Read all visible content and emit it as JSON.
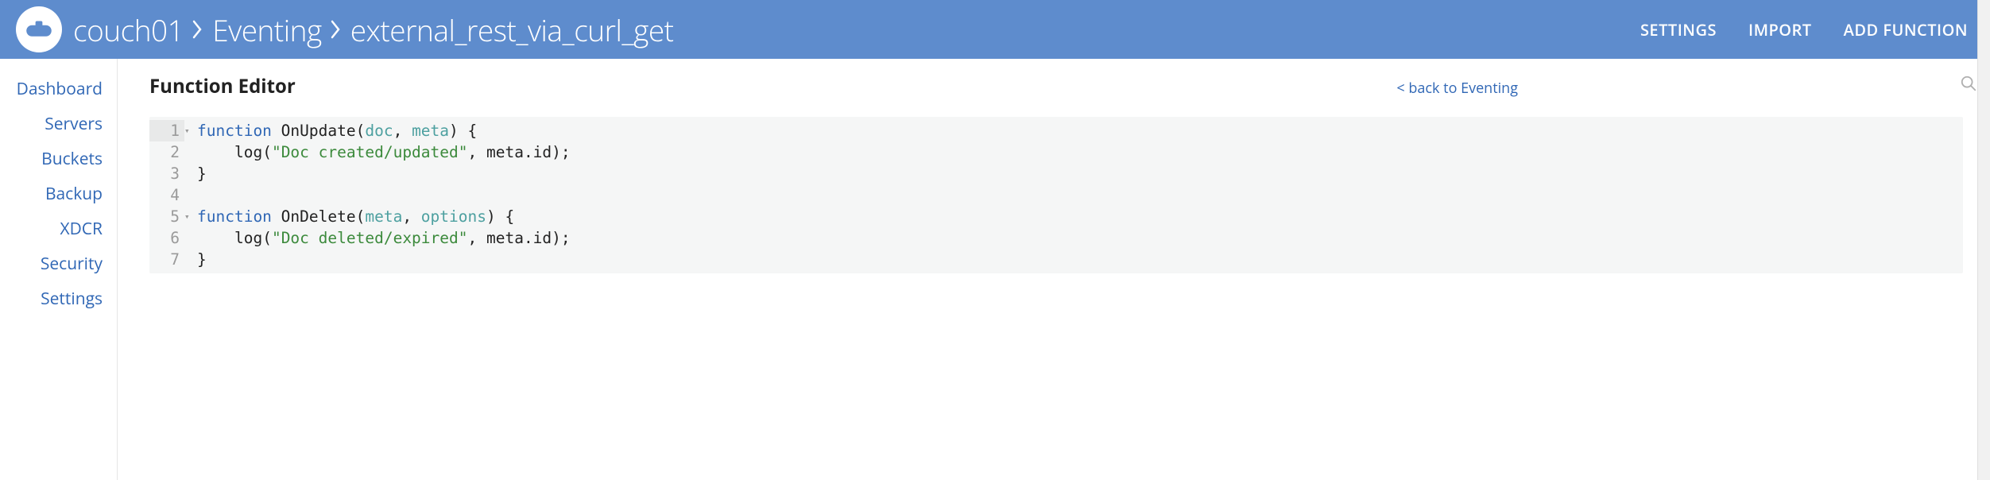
{
  "header": {
    "breadcrumb": [
      "couch01",
      "Eventing",
      "external_rest_via_curl_get"
    ],
    "actions": {
      "settings": "SETTINGS",
      "import": "IMPORT",
      "add_function": "ADD FUNCTION"
    }
  },
  "sidebar": {
    "items": [
      "Dashboard",
      "Servers",
      "Buckets",
      "Backup",
      "XDCR",
      "Security",
      "Settings"
    ]
  },
  "main": {
    "title": "Function Editor",
    "back_link": "< back to Eventing"
  },
  "code": {
    "lines": [
      {
        "num": "1",
        "fold": true,
        "tokens": [
          [
            "kw",
            "function"
          ],
          [
            "sp",
            " "
          ],
          [
            "fn",
            "OnUpdate"
          ],
          [
            "punc",
            "("
          ],
          [
            "arg",
            "doc"
          ],
          [
            "punc",
            ", "
          ],
          [
            "arg",
            "meta"
          ],
          [
            "punc",
            ") {"
          ]
        ]
      },
      {
        "num": "2",
        "fold": false,
        "tokens": [
          [
            "sp",
            "    "
          ],
          [
            "fn",
            "log"
          ],
          [
            "punc",
            "("
          ],
          [
            "str",
            "\"Doc created/updated\""
          ],
          [
            "punc",
            ", "
          ],
          [
            "id",
            "meta.id"
          ],
          [
            "punc",
            ");"
          ]
        ]
      },
      {
        "num": "3",
        "fold": false,
        "tokens": [
          [
            "punc",
            "}"
          ]
        ]
      },
      {
        "num": "4",
        "fold": false,
        "tokens": []
      },
      {
        "num": "5",
        "fold": true,
        "tokens": [
          [
            "kw",
            "function"
          ],
          [
            "sp",
            " "
          ],
          [
            "fn",
            "OnDelete"
          ],
          [
            "punc",
            "("
          ],
          [
            "arg",
            "meta"
          ],
          [
            "punc",
            ", "
          ],
          [
            "arg",
            "options"
          ],
          [
            "punc",
            ") {"
          ]
        ]
      },
      {
        "num": "6",
        "fold": false,
        "tokens": [
          [
            "sp",
            "    "
          ],
          [
            "fn",
            "log"
          ],
          [
            "punc",
            "("
          ],
          [
            "str",
            "\"Doc deleted/expired\""
          ],
          [
            "punc",
            ", "
          ],
          [
            "id",
            "meta.id"
          ],
          [
            "punc",
            ");"
          ]
        ]
      },
      {
        "num": "7",
        "fold": false,
        "tokens": [
          [
            "punc",
            "}"
          ]
        ]
      }
    ]
  }
}
